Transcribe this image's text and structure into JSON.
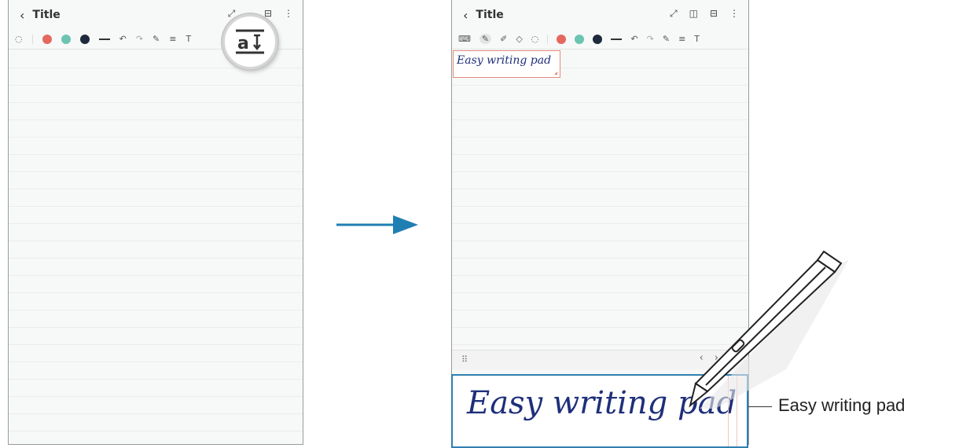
{
  "left_screen": {
    "back": "‹",
    "title": "Title",
    "header_icons": [
      "expand-icon",
      "split-view-icon",
      "page-icon",
      "more-icon"
    ],
    "toolbar_icons": [
      "lasso-icon",
      "color-red",
      "color-teal",
      "color-dark",
      "line-weight",
      "undo-icon",
      "redo-icon",
      "pen-settings-icon",
      "text-style-icon",
      "writing-pad-icon",
      "lock-icon"
    ],
    "magnifier_icon": "handwriting-to-text-icon"
  },
  "right_screen": {
    "back": "‹",
    "title": "Title",
    "header_icons": [
      "expand-icon",
      "split-view-icon",
      "page-icon",
      "more-icon"
    ],
    "toolbar_icons": [
      "keyboard-icon",
      "pen-icon",
      "highlighter-icon",
      "eraser-icon",
      "lasso-icon",
      "color-red",
      "color-teal",
      "color-dark",
      "line-weight",
      "undo-icon",
      "redo-icon",
      "pen-settings-icon",
      "text-style-icon",
      "writing-pad-icon"
    ],
    "text_box": "Easy writing pad",
    "pad_nav": [
      "‹",
      "›"
    ],
    "pad_grip": "⠿"
  },
  "writing_pad": {
    "handwriting": "Easy writing pad"
  },
  "callout": {
    "label": "Easy writing pad"
  },
  "colors": {
    "red": "#e5685f",
    "teal": "#6cc4b2",
    "dark": "#1e2a3b",
    "arrow": "#1f7fb3",
    "pad_border": "#2f7fb0",
    "ink": "#1e2f7a"
  }
}
